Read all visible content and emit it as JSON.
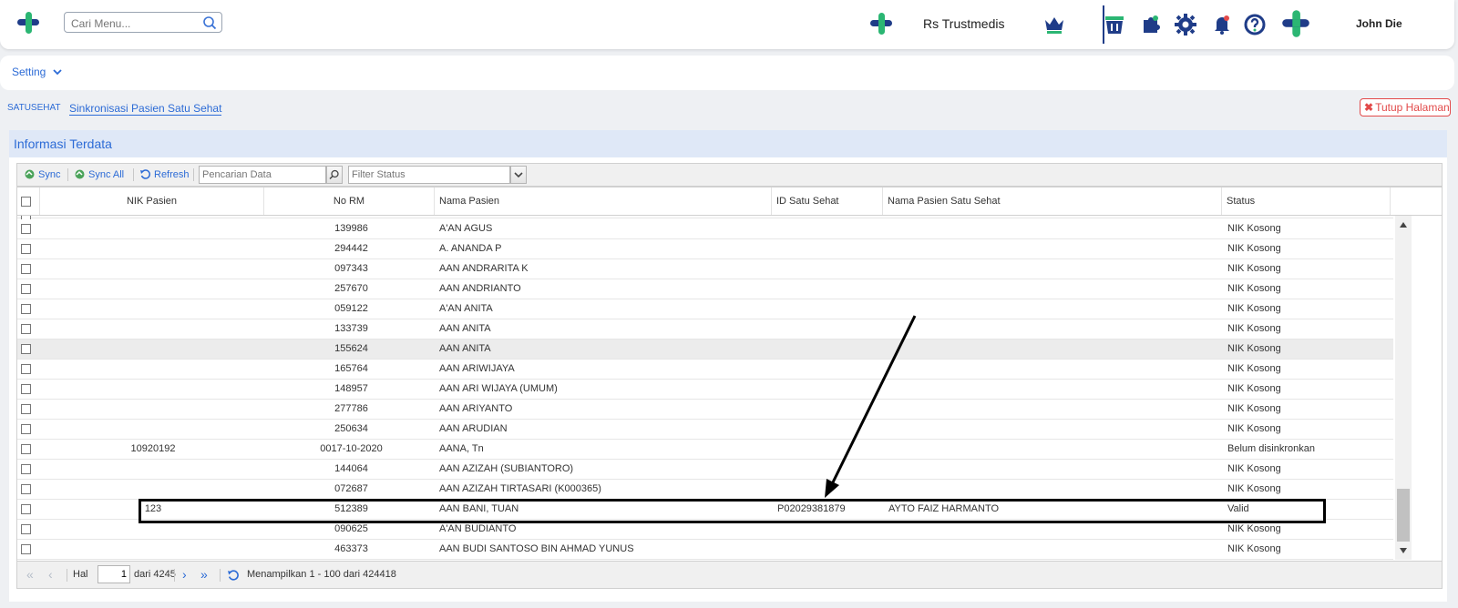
{
  "header": {
    "search_placeholder": "Cari Menu...",
    "hospital_name": "Rs Trustmedis",
    "user_name": "John Die",
    "icons": [
      "logo-icon",
      "search-icon",
      "crown-icon",
      "basket-icon",
      "puzzle-icon",
      "gear-icon",
      "bell-icon",
      "help-icon",
      "brand-icon"
    ],
    "colors": {
      "brand_green": "#2bb673",
      "brand_blue": "#1f3c88",
      "link": "#2c6bd6"
    }
  },
  "setting_menu": {
    "label": "Setting"
  },
  "breadcrumb": {
    "root": "SATUSEHAT",
    "current": "Sinkronisasi Pasien Satu Sehat",
    "close_label": "Tutup Halaman"
  },
  "panel": {
    "title": "Informasi Terdata",
    "toolbar": {
      "sync": "Sync",
      "sync_all": "Sync All",
      "refresh": "Refresh",
      "search_placeholder": "Pencarian Data",
      "filter_placeholder": "Filter Status"
    },
    "columns": {
      "nik": "NIK Pasien",
      "rm": "No RM",
      "name": "Nama Pasien",
      "id_ss": "ID Satu Sehat",
      "name_ss": "Nama Pasien Satu Sehat",
      "status": "Status"
    },
    "rows": [
      {
        "nik": "",
        "rm": "139986",
        "name": "A'AN AGUS",
        "id_ss": "",
        "name_ss": "",
        "status": "NIK Kosong"
      },
      {
        "nik": "",
        "rm": "294442",
        "name": "A. ANANDA P",
        "id_ss": "",
        "name_ss": "",
        "status": "NIK Kosong"
      },
      {
        "nik": "",
        "rm": "097343",
        "name": "AAN ANDRARITA K",
        "id_ss": "",
        "name_ss": "",
        "status": "NIK Kosong"
      },
      {
        "nik": "",
        "rm": "257670",
        "name": "AAN ANDRIANTO",
        "id_ss": "",
        "name_ss": "",
        "status": "NIK Kosong"
      },
      {
        "nik": "",
        "rm": "059122",
        "name": "A'AN ANITA",
        "id_ss": "",
        "name_ss": "",
        "status": "NIK Kosong"
      },
      {
        "nik": "",
        "rm": "133739",
        "name": "AAN ANITA",
        "id_ss": "",
        "name_ss": "",
        "status": "NIK Kosong"
      },
      {
        "nik": "",
        "rm": "155624",
        "name": "AAN ANITA",
        "id_ss": "",
        "name_ss": "",
        "status": "NIK Kosong"
      },
      {
        "nik": "",
        "rm": "165764",
        "name": "AAN ARIWIJAYA",
        "id_ss": "",
        "name_ss": "",
        "status": "NIK Kosong"
      },
      {
        "nik": "",
        "rm": "148957",
        "name": "AAN ARI WIJAYA (UMUM)",
        "id_ss": "",
        "name_ss": "",
        "status": "NIK Kosong"
      },
      {
        "nik": "",
        "rm": "277786",
        "name": "AAN ARIYANTO",
        "id_ss": "",
        "name_ss": "",
        "status": "NIK Kosong"
      },
      {
        "nik": "",
        "rm": "250634",
        "name": "AAN ARUDIAN",
        "id_ss": "",
        "name_ss": "",
        "status": "NIK Kosong"
      },
      {
        "nik": "10920192",
        "rm": "0017-10-2020",
        "name": "AANA, Tn",
        "id_ss": "",
        "name_ss": "",
        "status": "Belum disinkronkan"
      },
      {
        "nik": "",
        "rm": "144064",
        "name": "AAN AZIZAH (SUBIANTORO)",
        "id_ss": "",
        "name_ss": "",
        "status": "NIK Kosong"
      },
      {
        "nik": "",
        "rm": "072687",
        "name": "AAN AZIZAH TIRTASARI (K000365)",
        "id_ss": "",
        "name_ss": "",
        "status": "NIK Kosong"
      },
      {
        "nik": "123",
        "rm": "512389",
        "name": "AAN BANI, TUAN",
        "id_ss": "P02029381879",
        "name_ss": "AYTO FAIZ HARMANTO",
        "status": "Valid"
      },
      {
        "nik": "",
        "rm": "090625",
        "name": "A'AN BUDIANTO",
        "id_ss": "",
        "name_ss": "",
        "status": "NIK Kosong"
      },
      {
        "nik": "",
        "rm": "463373",
        "name": "AAN BUDI SANTOSO BIN AHMAD YUNUS",
        "id_ss": "",
        "name_ss": "",
        "status": "NIK Kosong"
      }
    ],
    "pager": {
      "page_label": "Hal",
      "page_value": "1",
      "of_label": "dari 4245",
      "display_text": "Menampilkan 1 - 100 dari 424418"
    }
  }
}
